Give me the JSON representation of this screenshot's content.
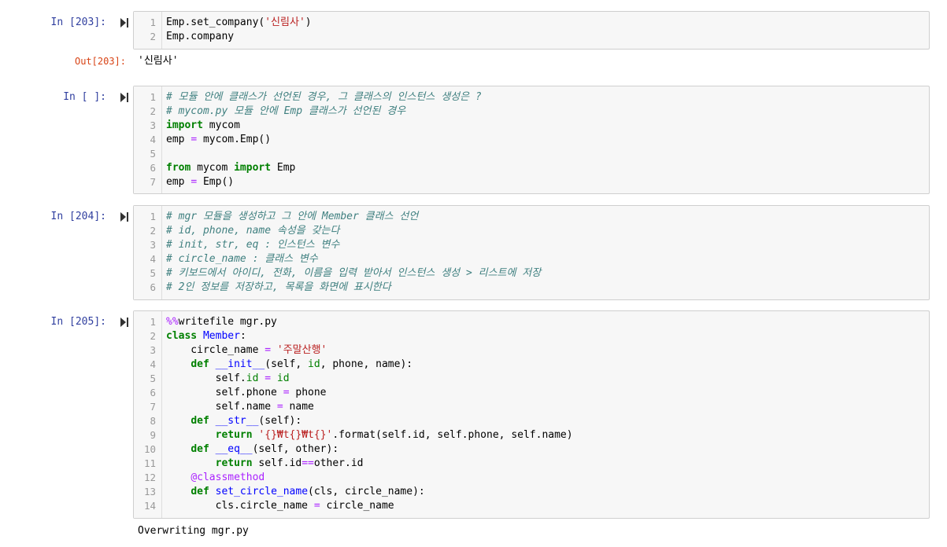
{
  "cells": [
    {
      "prompt": "In [203]:",
      "lines": [
        [
          {
            "t": "Emp.set_company("
          },
          {
            "t": "'신림사'",
            "c": "str"
          },
          {
            "t": ")"
          }
        ],
        [
          {
            "t": "Emp.company"
          }
        ]
      ],
      "output_prompt": "Out[203]:",
      "output": "'신림사'"
    },
    {
      "prompt": "In [ ]:",
      "lines": [
        [
          {
            "t": "# 모듈 안에 클래스가 선언된 경우, 그 클래스의 인스턴스 생성은 ?",
            "c": "cm"
          }
        ],
        [
          {
            "t": "# mycom.py 모듈 안에 Emp 클래스가 선언된 경우",
            "c": "cm"
          }
        ],
        [
          {
            "t": "import",
            "c": "kw"
          },
          {
            "t": " mycom"
          }
        ],
        [
          {
            "t": "emp "
          },
          {
            "t": "=",
            "c": "op"
          },
          {
            "t": " mycom.Emp()"
          }
        ],
        [
          {
            "t": ""
          }
        ],
        [
          {
            "t": "from",
            "c": "kw"
          },
          {
            "t": " mycom "
          },
          {
            "t": "import",
            "c": "kw"
          },
          {
            "t": " Emp"
          }
        ],
        [
          {
            "t": "emp "
          },
          {
            "t": "=",
            "c": "op"
          },
          {
            "t": " Emp()"
          }
        ]
      ]
    },
    {
      "prompt": "In [204]:",
      "lines": [
        [
          {
            "t": "# mgr 모듈을 생성하고 그 안에 Member 클래스 선언",
            "c": "cm"
          }
        ],
        [
          {
            "t": "# id, phone, name 속성을 갖는다",
            "c": "cm"
          }
        ],
        [
          {
            "t": "# init, str, eq : 인스턴스 변수",
            "c": "cm"
          }
        ],
        [
          {
            "t": "# circle_name : 클래스 변수",
            "c": "cm"
          }
        ],
        [
          {
            "t": "# 키보드에서 아이디, 전화, 이름을 입력 받아서 인스턴스 생성 > 리스트에 저장",
            "c": "cm"
          }
        ],
        [
          {
            "t": "# 2인 정보를 저장하고, 목록을 화면에 표시한다",
            "c": "cm"
          }
        ]
      ]
    },
    {
      "prompt": "In [205]:",
      "lines": [
        [
          {
            "t": "%%",
            "c": "magic"
          },
          {
            "t": "writefile mgr.py"
          }
        ],
        [
          {
            "t": "class",
            "c": "kw"
          },
          {
            "t": " "
          },
          {
            "t": "Member",
            "c": "cls"
          },
          {
            "t": ":"
          }
        ],
        [
          {
            "t": "    circle_name "
          },
          {
            "t": "=",
            "c": "op"
          },
          {
            "t": " "
          },
          {
            "t": "'주말산행'",
            "c": "str"
          }
        ],
        [
          {
            "t": "    "
          },
          {
            "t": "def",
            "c": "kw"
          },
          {
            "t": " "
          },
          {
            "t": "__init__",
            "c": "fn"
          },
          {
            "t": "(self, "
          },
          {
            "t": "id",
            "c": "bi"
          },
          {
            "t": ", phone, name):"
          }
        ],
        [
          {
            "t": "        self."
          },
          {
            "t": "id",
            "c": "bi"
          },
          {
            "t": " "
          },
          {
            "t": "=",
            "c": "op"
          },
          {
            "t": " "
          },
          {
            "t": "id",
            "c": "bi"
          }
        ],
        [
          {
            "t": "        self.phone "
          },
          {
            "t": "=",
            "c": "op"
          },
          {
            "t": " phone"
          }
        ],
        [
          {
            "t": "        self.name "
          },
          {
            "t": "=",
            "c": "op"
          },
          {
            "t": " name"
          }
        ],
        [
          {
            "t": "    "
          },
          {
            "t": "def",
            "c": "kw"
          },
          {
            "t": " "
          },
          {
            "t": "__str__",
            "c": "fn"
          },
          {
            "t": "(self):"
          }
        ],
        [
          {
            "t": "        "
          },
          {
            "t": "return",
            "c": "kw"
          },
          {
            "t": " "
          },
          {
            "t": "'{}₩t{}₩t{}'",
            "c": "str"
          },
          {
            "t": ".format(self.id, self.phone, self.name)"
          }
        ],
        [
          {
            "t": "    "
          },
          {
            "t": "def",
            "c": "kw"
          },
          {
            "t": " "
          },
          {
            "t": "__eq__",
            "c": "fn"
          },
          {
            "t": "(self, other):"
          }
        ],
        [
          {
            "t": "        "
          },
          {
            "t": "return",
            "c": "kw"
          },
          {
            "t": " self.id"
          },
          {
            "t": "==",
            "c": "op"
          },
          {
            "t": "other.id"
          }
        ],
        [
          {
            "t": "    "
          },
          {
            "t": "@classmethod",
            "c": "deco"
          }
        ],
        [
          {
            "t": "    "
          },
          {
            "t": "def",
            "c": "kw"
          },
          {
            "t": " "
          },
          {
            "t": "set_circle_name",
            "c": "fn"
          },
          {
            "t": "(cls, circle_name):"
          }
        ],
        [
          {
            "t": "        cls.circle_name "
          },
          {
            "t": "=",
            "c": "op"
          },
          {
            "t": " circle_name"
          }
        ]
      ],
      "stream_output": "Overwriting mgr.py"
    }
  ]
}
